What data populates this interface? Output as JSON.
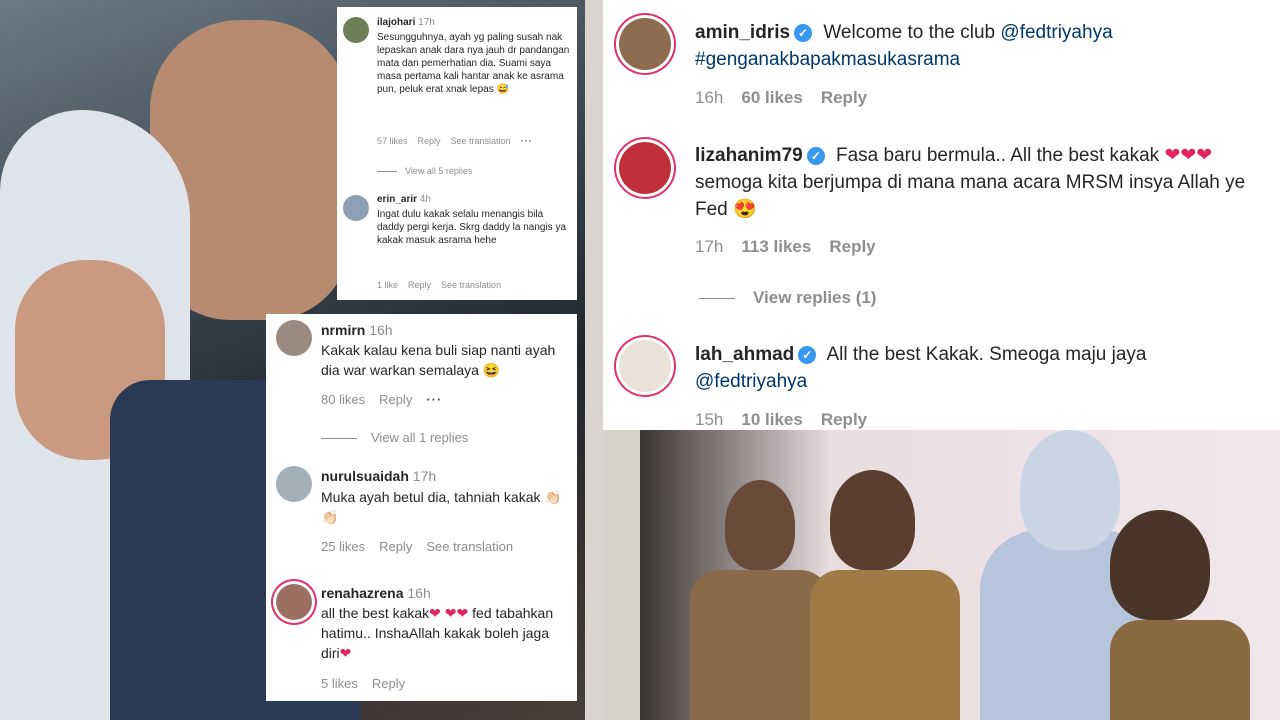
{
  "cardA": {
    "comments": [
      {
        "user": "ilajohari",
        "time": "17h",
        "text": "Sesungguhnya, ayah yg paling susah nak lepaskan anak dara nya jauh dr pandangan mata dan pemerhatian dia. Suami saya masa pertama kali hantar anak ke asrama pun, peluk erat xnak lepas 😅",
        "likes": "57 likes",
        "reply": "Reply",
        "translate": "See translation",
        "more": "···",
        "view_replies": "View all 5 replies"
      },
      {
        "user": "erin_arir",
        "time": "4h",
        "text": "Ingat dulu kakak selalu menangis bila daddy pergi kerja. Skrg daddy la nangis ya kakak masuk asrama hehe",
        "likes": "1 like",
        "reply": "Reply",
        "translate": "See translation"
      }
    ]
  },
  "cardB": {
    "comments": [
      {
        "user": "nrmirn",
        "time": "16h",
        "text": "Kakak kalau kena buli siap nanti ayah dia war warkan semalaya 😆",
        "likes": "80 likes",
        "reply": "Reply",
        "more": "···",
        "view_replies": "View all 1 replies"
      },
      {
        "user": "nurulsuaidah",
        "time": "17h",
        "text": "Muka ayah betul dia, tahniah kakak 👏🏻👏🏻",
        "likes": "25 likes",
        "reply": "Reply",
        "translate": "See translation"
      },
      {
        "user": "renahazrena",
        "time": "16h",
        "text_before": "all the best kakak",
        "hearts_1": "❤ ❤❤",
        "text_mid": "fed tabahkan hatimu.. InshaAllah kakak boleh jaga diri",
        "hearts_2": "❤",
        "likes": "5 likes",
        "reply": "Reply"
      }
    ]
  },
  "cardC": {
    "comments": [
      {
        "user": "amin_idris",
        "verified": "✓",
        "text": "Welcome to the club",
        "mention": "@fedtriyahya",
        "hashtag": "#genganakbapakmasukasrama",
        "time": "16h",
        "likes": "60 likes",
        "reply": "Reply"
      },
      {
        "user": "lizahanim79",
        "verified": "✓",
        "text": "Fasa baru bermula.. All the best kakak",
        "hearts": "❤❤❤",
        "text2": "semoga kita berjumpa di mana mana acara MRSM insya Allah ye Fed 😍",
        "time": "17h",
        "likes": "113 likes",
        "reply": "Reply",
        "view_replies": "View replies (1)"
      },
      {
        "user": "lah_ahmad",
        "verified": "✓",
        "text": "All the best Kakak. Smeoga maju jaya",
        "mention": "@fedtriyahya",
        "time": "15h",
        "likes": "10 likes",
        "reply": "Reply"
      }
    ]
  },
  "colors": {
    "link": "#00376b",
    "verified": "#3897f0",
    "heart": "#e0245e",
    "muted": "#8e8e8e"
  }
}
